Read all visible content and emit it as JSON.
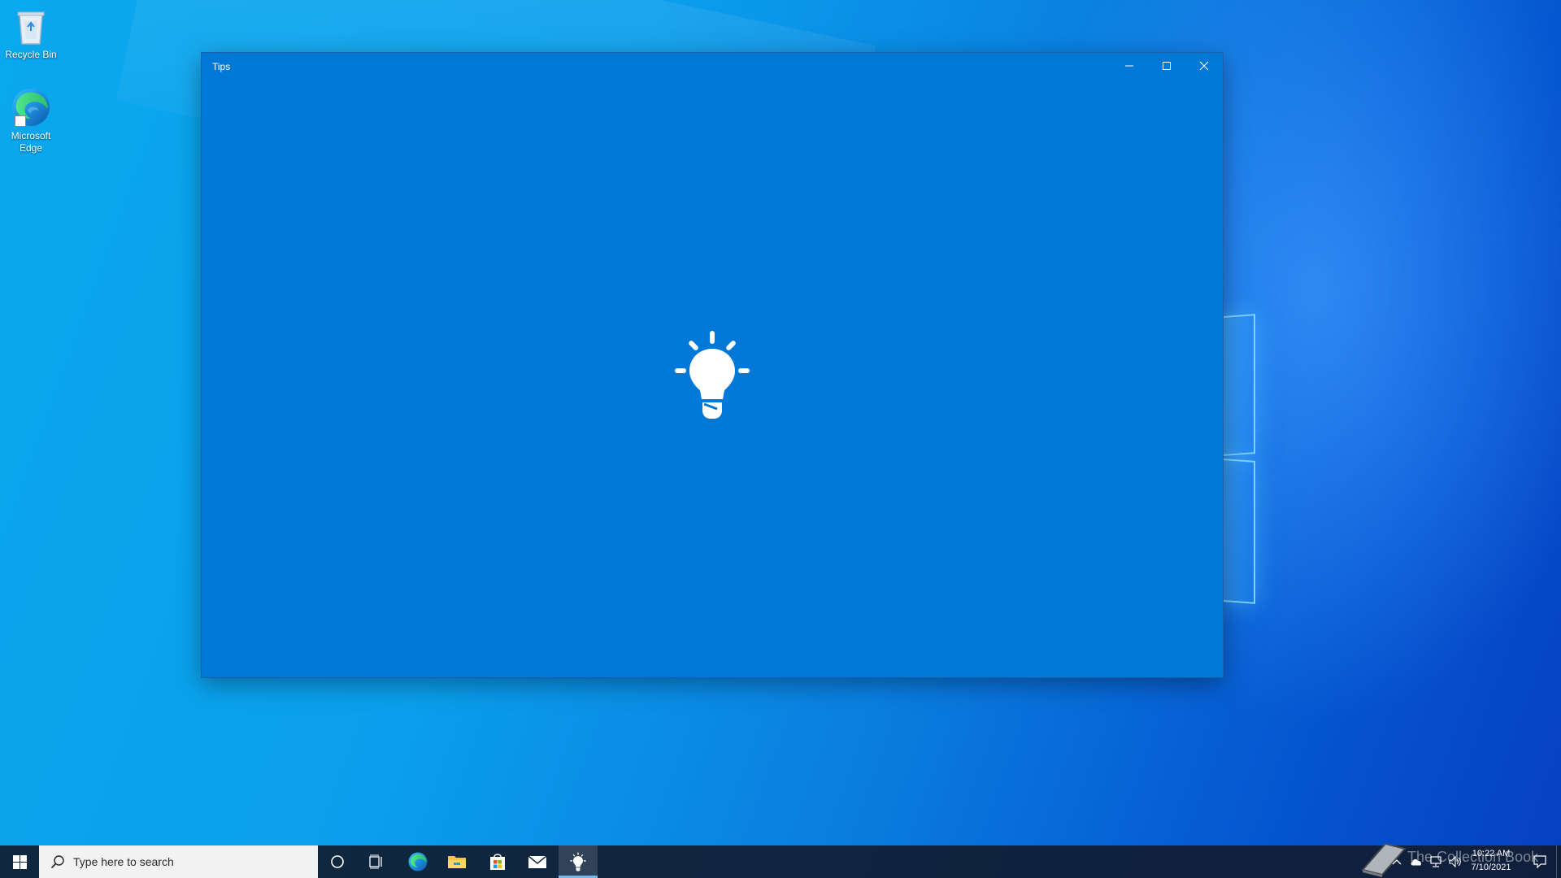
{
  "desktop": {
    "icons": [
      {
        "label": "Recycle Bin",
        "icon": "recycle-bin-icon"
      },
      {
        "label": "Microsoft Edge",
        "icon": "edge-icon"
      }
    ]
  },
  "window": {
    "title": "Tips",
    "splash_icon": "lightbulb-icon",
    "background_color": "#0078d7",
    "controls": {
      "minimize": "minimize-icon",
      "maximize": "maximize-icon",
      "close": "close-icon"
    }
  },
  "taskbar": {
    "search_placeholder": "Type here to search",
    "pinned": [
      "cortana-icon",
      "task-view-icon",
      "edge-icon",
      "file-explorer-icon",
      "store-icon",
      "mail-icon",
      "tips-icon"
    ],
    "active_app": "Tips",
    "watermark": "The Collection Book",
    "clock": {
      "time": "10:22 AM",
      "date": "7/10/2021"
    }
  }
}
